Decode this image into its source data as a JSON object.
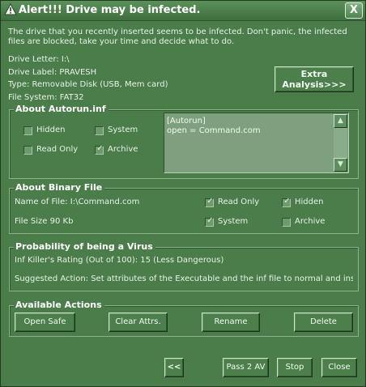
{
  "window": {
    "title": "Alert!!! Drive may be infected.",
    "close_label": "X"
  },
  "intro_text": "The drive that you recently inserted seems to be infected. Don't panic, the infected files are blocked, take your time and decide what to do.",
  "drive": {
    "letter": "Drive Letter:  I:\\",
    "label": "Drive Label:  PRAVESH",
    "type": "Type:  Removable Disk (USB, Mem card)",
    "filesystem": "File System:  FAT32"
  },
  "extra_button": {
    "line1": "Extra",
    "line2": "Analysis>>>"
  },
  "autorun": {
    "title": "About Autorun.inf",
    "checkboxes": [
      {
        "label": "Hidden",
        "checked": false
      },
      {
        "label": "System",
        "checked": false
      },
      {
        "label": "Read Only",
        "checked": false
      },
      {
        "label": "Archive",
        "checked": true
      }
    ],
    "content_line1": "[Autorun]",
    "content_line2": "open = Command.com"
  },
  "binary": {
    "title": "About Binary File",
    "name": "Name of File:  I:\\Command.com",
    "size": "File Size 90 Kb",
    "checkboxes": [
      {
        "label": "Read Only",
        "checked": true
      },
      {
        "label": "Hidden",
        "checked": true
      },
      {
        "label": "System",
        "checked": true
      },
      {
        "label": "Archive",
        "checked": false
      }
    ]
  },
  "probability": {
    "title": "Probability of being a Virus",
    "rating": "Inf Killer's Rating (Out of 100):  15 (Less Dangerous)",
    "suggested": "Suggested Action: Set attributes of the Executable and the inf file to normal and inspect"
  },
  "actions": {
    "title": "Available Actions",
    "open_safe": "Open Safe",
    "clear_attrs": "Clear Attrs.",
    "rename": "Rename",
    "delete": "Delete"
  },
  "footer": {
    "back": "<<",
    "pass_av": "Pass 2 AV",
    "stop": "Stop",
    "close": "Close"
  },
  "colors": {
    "background": "#4a7d4a",
    "title_gradient_top": "#5b915b",
    "text": "#e8f2e8"
  }
}
